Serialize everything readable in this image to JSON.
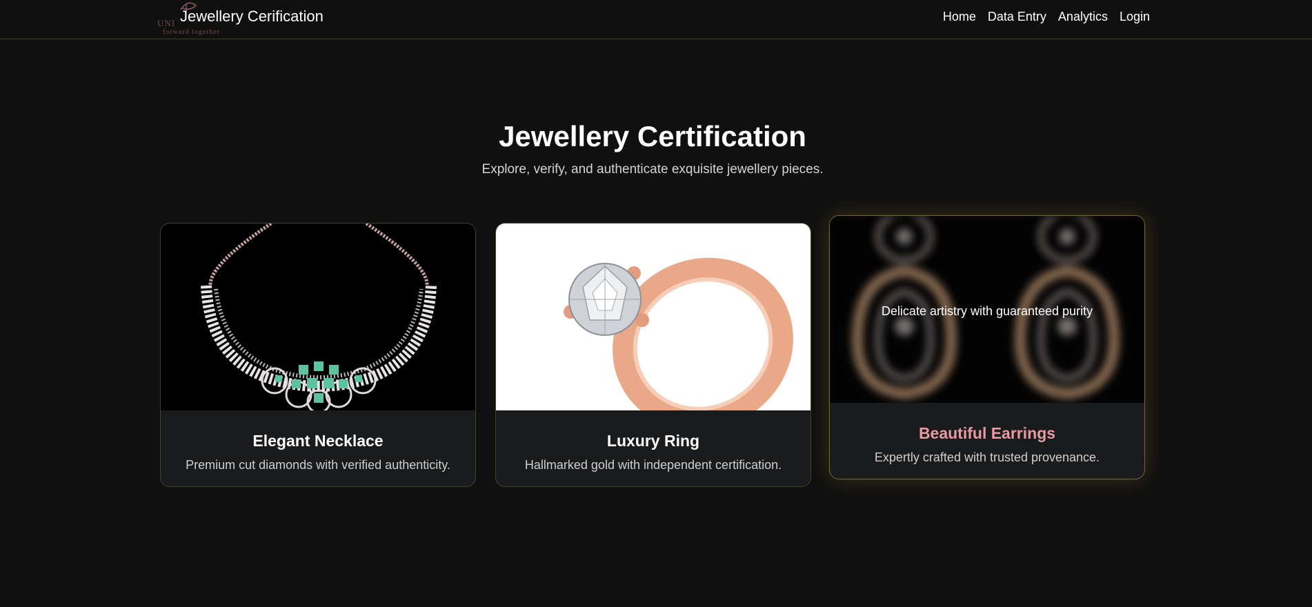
{
  "nav": {
    "brand_title": "Jewellery Cerification",
    "logo_word": "UNI",
    "logo_tag": "forward together",
    "links": [
      "Home",
      "Data Entry",
      "Analytics",
      "Login"
    ]
  },
  "hero": {
    "title": "Jewellery Certification",
    "subtitle": "Explore, verify, and authenticate exquisite jewellery pieces."
  },
  "cards": [
    {
      "title": "Elegant Necklace",
      "description": "Premium cut diamonds with verified authenticity."
    },
    {
      "title": "Luxury Ring",
      "description": "Hallmarked gold with independent certification."
    },
    {
      "title": "Beautiful Earrings",
      "description": "Expertly crafted with trusted provenance.",
      "overlay": "Delicate artistry with guaranteed purity"
    }
  ],
  "colors": {
    "background": "#101010",
    "card_background": "#1a1b1d",
    "border_gold": "#4a4128",
    "highlight_pink": "#e79aa2"
  }
}
